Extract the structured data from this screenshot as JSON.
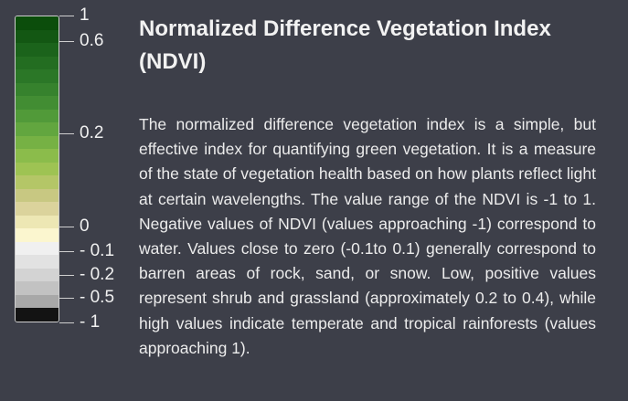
{
  "legend": {
    "ticks": [
      {
        "label": "1",
        "value": 1
      },
      {
        "label": "0.6",
        "value": 0.6
      },
      {
        "label": "0.2",
        "value": 0.2
      },
      {
        "label": "0",
        "value": 0
      },
      {
        "label": "- 0.1",
        "value": -0.1
      },
      {
        "label": "- 0.2",
        "value": -0.2
      },
      {
        "label": "- 0.5",
        "value": -0.5
      },
      {
        "label": "- 1",
        "value": -1
      }
    ],
    "colors": [
      "#0b4d0b",
      "#135713",
      "#1b631b",
      "#236d21",
      "#2b7727",
      "#36822d",
      "#428d33",
      "#519a39",
      "#62a63f",
      "#76b144",
      "#8bbc4b",
      "#9ec353",
      "#b4c667",
      "#c8c882",
      "#dbd39c",
      "#ede7b4",
      "#fbf6cf",
      "#f0f0f0",
      "#e2e2e2",
      "#d3d3d3",
      "#c2c2c2",
      "#a8a8a8",
      "#131313"
    ]
  },
  "title": "Normalized Difference Vegetation Index (NDVI)",
  "description": "The normalized difference vegetation index is a simple, but effective index for quantifying green vegetation. It is a measure of the state of vegetation health based on how plants reflect light at certain wavelengths. The value range of the NDVI is -1 to 1. Negative values of NDVI (values approaching -1) correspond to water. Values close to zero (-0.1to 0.1) generally correspond to barren areas of rock, sand, or snow. Low, positive values represent shrub and grassland (approximately 0.2 to 0.4), while high values indicate temperate and tropical rainforests (values approaching 1)."
}
